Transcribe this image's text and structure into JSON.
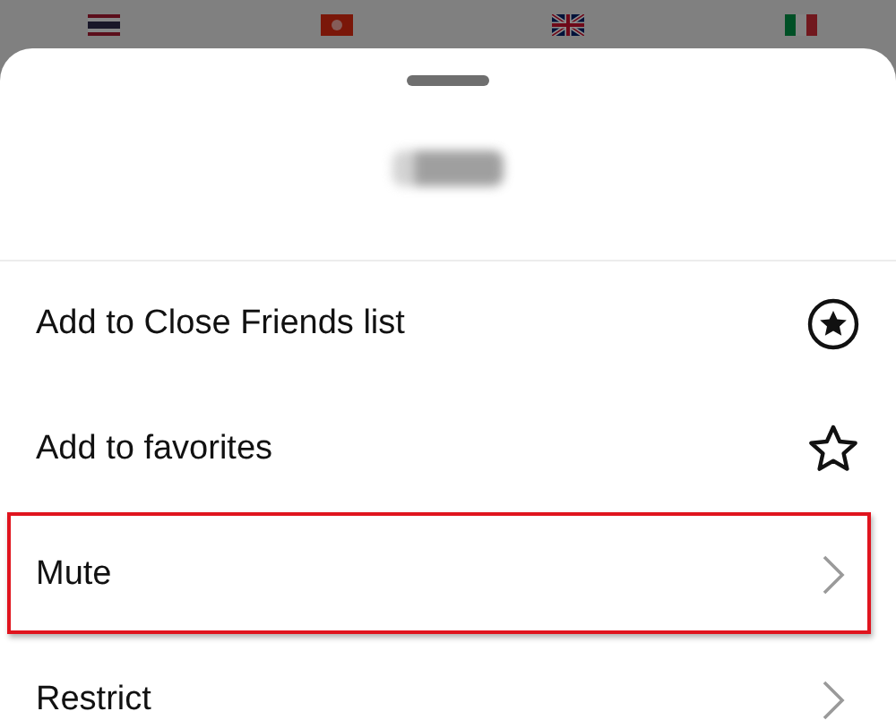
{
  "background": {
    "flags": [
      {
        "kind": "thailand"
      },
      {
        "kind": "hongkong"
      },
      {
        "kind": "uk"
      },
      {
        "kind": "italy"
      }
    ]
  },
  "sheet": {
    "username": {
      "redacted": true
    },
    "items": [
      {
        "label": "Add to Close Friends list",
        "kind": "badge",
        "highlighted": false
      },
      {
        "label": "Add to favorites",
        "kind": "favorite",
        "highlighted": false
      },
      {
        "label": "Mute",
        "kind": "submenu",
        "highlighted": true
      },
      {
        "label": "Restrict",
        "kind": "submenu",
        "highlighted": false
      }
    ]
  }
}
